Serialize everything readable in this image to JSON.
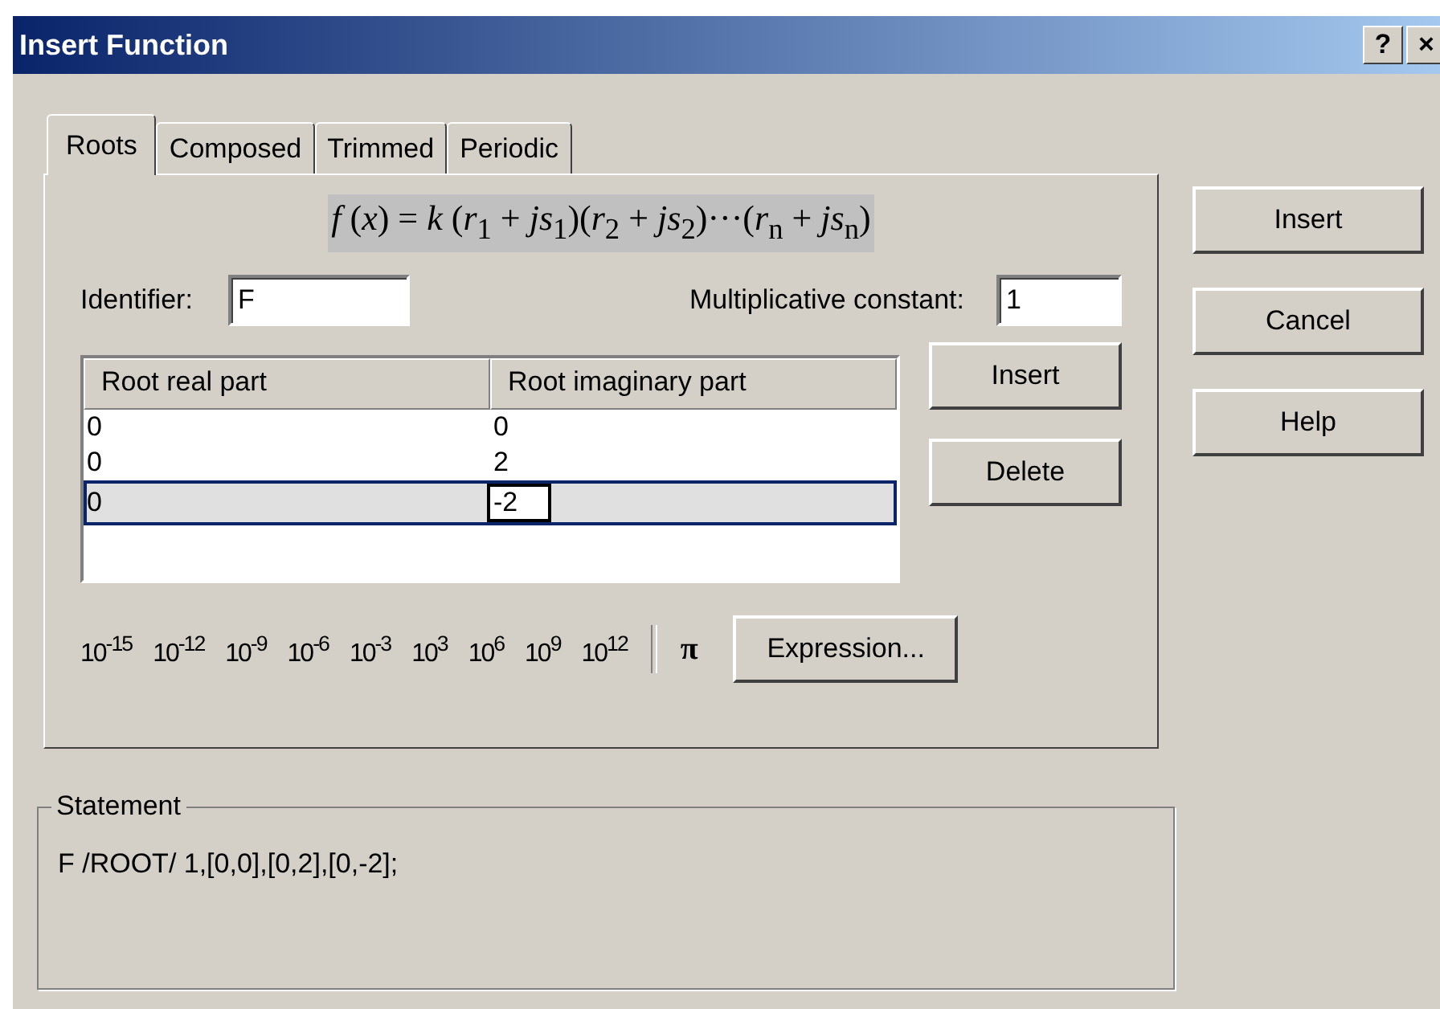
{
  "window": {
    "title": "Insert Function",
    "title_buttons": [
      "?",
      "×"
    ]
  },
  "tabs": [
    {
      "label": "Roots",
      "selected": true
    },
    {
      "label": "Composed",
      "selected": false
    },
    {
      "label": "Trimmed",
      "selected": false
    },
    {
      "label": "Periodic",
      "selected": false
    }
  ],
  "formula": "*f* (*x*) = *k* (*r*$_{1}$ + *js*$_{1}$)(*r*$_{2}$ + *js*$_{2}$)···(*r*$_{n}$ + *js*$_{n}$)",
  "identifier": {
    "label": "Identifier:",
    "value": "F"
  },
  "constant": {
    "label": "Multiplicative constant:",
    "value": "1"
  },
  "table": {
    "columns": [
      "Root real part",
      "Root imaginary part"
    ],
    "rows": [
      {
        "cells": [
          "0",
          "0"
        ],
        "selected": false,
        "editing": false
      },
      {
        "cells": [
          "0",
          "2"
        ],
        "selected": false,
        "editing": false
      },
      {
        "cells": [
          "0",
          "-2"
        ],
        "selected": true,
        "editing": true
      }
    ]
  },
  "table_buttons": [
    {
      "label": "Insert"
    },
    {
      "label": "Delete"
    }
  ],
  "powers": [
    "10$^{-15}$",
    "10$^{-12}$",
    "10$^{-9}$",
    "10$^{-6}$",
    "10$^{-3}$",
    "10$^{3}$",
    "10$^{6}$",
    "10$^{9}$",
    "10$^{12}$"
  ],
  "pi": "π",
  "expression_button": {
    "label": "Expression..."
  },
  "statement": {
    "legend": "Statement",
    "text": "F /ROOT/ 1,[0,0],[0,2],[0,-2];"
  },
  "dialog_buttons": [
    "Insert",
    "Cancel",
    "Help"
  ]
}
